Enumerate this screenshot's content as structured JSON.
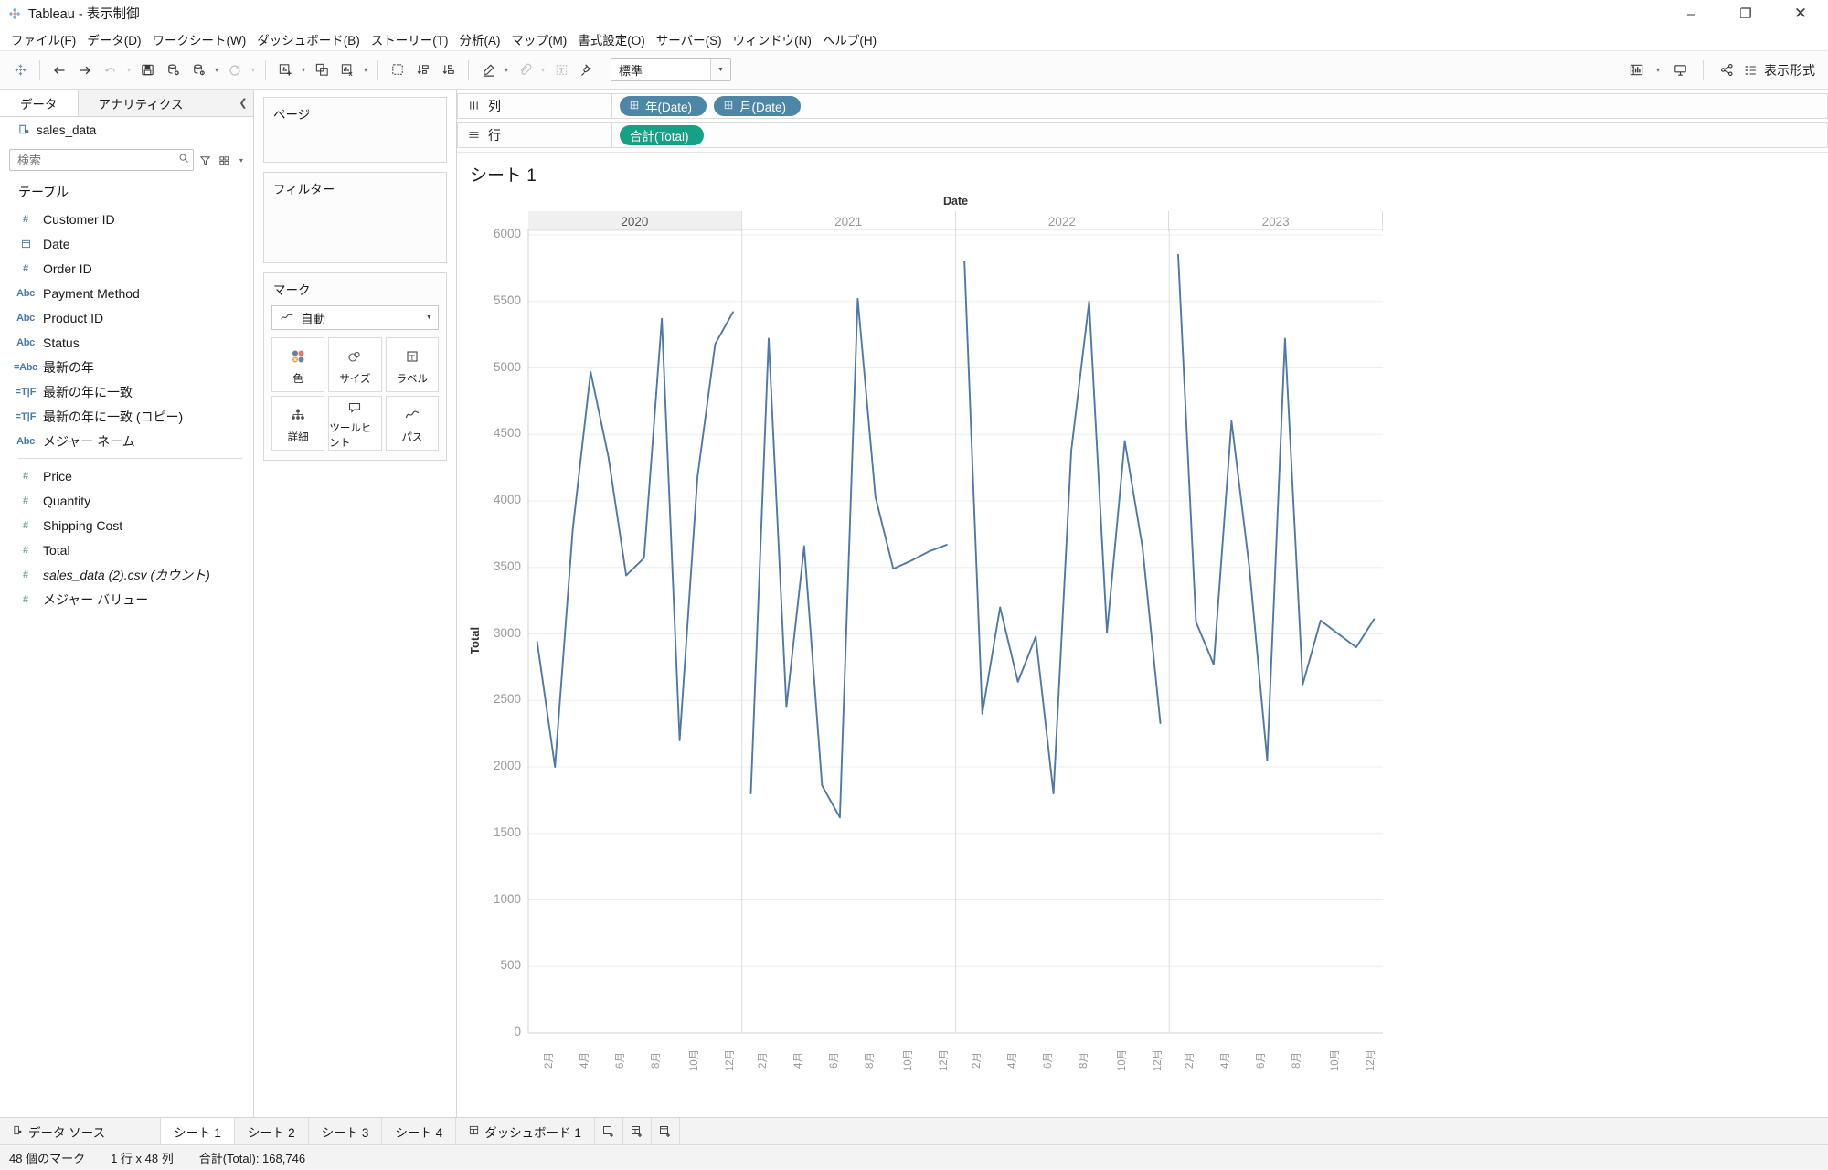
{
  "window": {
    "title": "Tableau - 表示制御",
    "app_icon": "tableau-logo-icon",
    "minimize": "–",
    "maximize": "❐",
    "close": "✕"
  },
  "menu": {
    "items": [
      "ファイル(F)",
      "データ(D)",
      "ワークシート(W)",
      "ダッシュボード(B)",
      "ストーリー(T)",
      "分析(A)",
      "マップ(M)",
      "書式設定(O)",
      "サーバー(S)",
      "ウィンドウ(N)",
      "ヘルプ(H)"
    ]
  },
  "toolbar": {
    "fit_value": "標準",
    "show_me_label": "表示形式",
    "buttons": [
      "tableau-home-icon",
      "undo-arrow-icon",
      "redo-arrow-icon",
      "refresh-icon",
      "save-icon",
      "new-data-source-icon",
      "pause-data-source-icon",
      "refresh-data-icon",
      "new-worksheet-icon",
      "duplicate-sheet-icon",
      "clear-sheet-icon",
      "swap-axes-icon",
      "sort-asc-icon",
      "sort-desc-icon",
      "highlight-icon",
      "group-icon",
      "labels-icon",
      "fix-axes-icon",
      "presentation-icon",
      "share-icon",
      "pin-icon"
    ]
  },
  "datapane": {
    "tabs": [
      {
        "label": "データ",
        "active": true
      },
      {
        "label": "アナリティクス",
        "active": false
      }
    ],
    "collapse_icon": "chevron-left-icon",
    "source": {
      "name": "sales_data",
      "icon": "data-source-icon"
    },
    "search": {
      "placeholder": "検索",
      "icon": "search-icon"
    },
    "filter_icon": "filter-icon",
    "view_icon": "view-options-icon",
    "group_header": "テーブル",
    "fields": [
      {
        "name": "Customer ID",
        "type": "number"
      },
      {
        "name": "Date",
        "type": "date"
      },
      {
        "name": "Order ID",
        "type": "number"
      },
      {
        "name": "Payment Method",
        "type": "abc"
      },
      {
        "name": "Product ID",
        "type": "abc"
      },
      {
        "name": "Status",
        "type": "abc"
      },
      {
        "name": "最新の年",
        "type": "calc-abc"
      },
      {
        "name": "最新の年に一致",
        "type": "calc-tf"
      },
      {
        "name": "最新の年に一致 (コピー)",
        "type": "calc-tf"
      },
      {
        "name": "メジャー ネーム",
        "type": "abc"
      }
    ],
    "measures": [
      {
        "name": "Price",
        "type": "number-green",
        "italic": false
      },
      {
        "name": "Quantity",
        "type": "number-green",
        "italic": false
      },
      {
        "name": "Shipping Cost",
        "type": "number-green",
        "italic": false
      },
      {
        "name": "Total",
        "type": "number-green",
        "italic": false
      },
      {
        "name": "sales_data (2).csv (カウント)",
        "type": "number-green",
        "italic": true
      },
      {
        "name": "メジャー バリュー",
        "type": "number-green",
        "italic": false
      }
    ]
  },
  "cards": {
    "pages": "ページ",
    "filters": "フィルター",
    "marks": {
      "title": "マーク",
      "type_value": "自動",
      "type_icon": "line-mark-icon",
      "buttons": [
        {
          "label": "色",
          "icon": "color-icon"
        },
        {
          "label": "サイズ",
          "icon": "size-icon"
        },
        {
          "label": "ラベル",
          "icon": "label-icon"
        },
        {
          "label": "詳細",
          "icon": "detail-icon"
        },
        {
          "label": "ツールヒント",
          "icon": "tooltip-icon"
        },
        {
          "label": "パス",
          "icon": "path-icon"
        }
      ]
    }
  },
  "shelves": {
    "columns": {
      "label": "列",
      "icon": "columns-icon",
      "pills": [
        {
          "text": "年(Date)",
          "color": "blue",
          "icon": "date-part-icon"
        },
        {
          "text": "月(Date)",
          "color": "blue",
          "icon": "date-part-icon"
        }
      ]
    },
    "rows": {
      "label": "行",
      "icon": "rows-icon",
      "pills": [
        {
          "text": "合計(Total)",
          "color": "green",
          "icon": ""
        }
      ]
    }
  },
  "sheet": {
    "title": "シート 1"
  },
  "chart_data": {
    "type": "line",
    "title": "シート 1",
    "xlabel": "Date",
    "ylabel": "Total",
    "ylim": [
      0,
      6000
    ],
    "yticks": [
      0,
      500,
      1000,
      1500,
      2000,
      2500,
      3000,
      3500,
      4000,
      4500,
      5000,
      5500,
      6000
    ],
    "grid": true,
    "legend": "none",
    "line_color": "#4e79a7",
    "panels": [
      "2020",
      "2021",
      "2022",
      "2023"
    ],
    "month_ticks": [
      "2月",
      "4月",
      "6月",
      "8月",
      "10月",
      "12月"
    ],
    "categories": [
      "2020-01",
      "2020-02",
      "2020-03",
      "2020-04",
      "2020-05",
      "2020-06",
      "2020-07",
      "2020-08",
      "2020-09",
      "2020-10",
      "2020-11",
      "2020-12",
      "2021-01",
      "2021-02",
      "2021-03",
      "2021-04",
      "2021-05",
      "2021-06",
      "2021-07",
      "2021-08",
      "2021-09",
      "2021-10",
      "2021-11",
      "2021-12",
      "2022-01",
      "2022-02",
      "2022-03",
      "2022-04",
      "2022-05",
      "2022-06",
      "2022-07",
      "2022-08",
      "2022-09",
      "2022-10",
      "2022-11",
      "2022-12",
      "2023-01",
      "2023-02",
      "2023-03",
      "2023-04",
      "2023-05",
      "2023-06",
      "2023-07",
      "2023-08",
      "2023-09",
      "2023-10",
      "2023-11",
      "2023-12"
    ],
    "series": [
      {
        "name": "合計(Total)",
        "values": [
          2940,
          2000,
          3790,
          4970,
          4330,
          3440,
          3570,
          5370,
          2200,
          4180,
          5180,
          5420,
          1800,
          5220,
          2450,
          3660,
          1860,
          1620,
          5520,
          4030,
          3490,
          3550,
          3620,
          3670,
          5800,
          2400,
          3200,
          2640,
          2980,
          1800,
          4380,
          5500,
          3010,
          4450,
          3650,
          2330,
          5850,
          3090,
          2770,
          4600,
          3500,
          2050,
          5220,
          2620,
          3100,
          3000,
          2900,
          3110
        ]
      }
    ]
  },
  "sheettabs": {
    "data_source": {
      "label": "データ ソース",
      "icon": "data-source-tab-icon"
    },
    "tabs": [
      {
        "label": "シート 1",
        "active": true
      },
      {
        "label": "シート 2",
        "active": false
      },
      {
        "label": "シート 3",
        "active": false
      },
      {
        "label": "シート 4",
        "active": false
      },
      {
        "label": "ダッシュボード 1",
        "active": false,
        "icon": "dashboard-icon"
      }
    ],
    "new_buttons": [
      "new-worksheet-icon",
      "new-dashboard-icon",
      "new-story-icon"
    ]
  },
  "statusbar": {
    "marks": "48 個のマーク",
    "dimensions": "1 行 x 48 列",
    "total": "合計(Total): 168,746"
  }
}
